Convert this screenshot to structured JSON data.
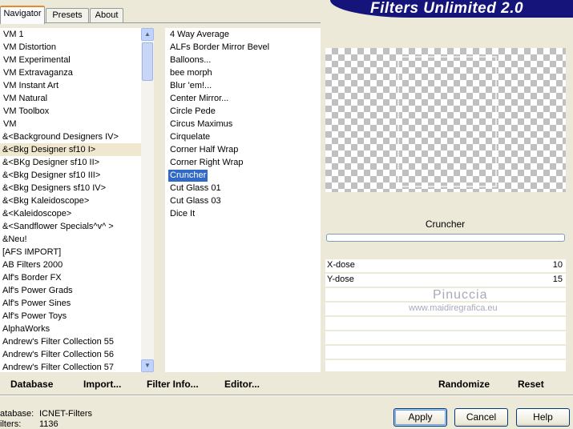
{
  "tabs": [
    {
      "label": "Navigator"
    },
    {
      "label": "Presets"
    },
    {
      "label": "About"
    }
  ],
  "title": "Filters Unlimited 2.0",
  "categories": [
    "VM 1",
    "VM Distortion",
    "VM Experimental",
    "VM Extravaganza",
    "VM Instant Art",
    "VM Natural",
    "VM Toolbox",
    "VM",
    "&<Background Designers IV>",
    "&<Bkg Designer sf10 I>",
    "&<BKg Designer sf10 II>",
    "&<Bkg Designer sf10 III>",
    "&<Bkg Designers sf10 IV>",
    "&<Bkg Kaleidoscope>",
    "&<Kaleidoscope>",
    "&<Sandflower Specials^v^ >",
    "&Neu!",
    "[AFS IMPORT]",
    "AB Filters 2000",
    "Alf's Border FX",
    "Alf's Power Grads",
    "Alf's Power Sines",
    "Alf's Power Toys",
    "AlphaWorks",
    "Andrew's Filter Collection 55",
    "Andrew's Filter Collection 56",
    "Andrew's Filter Collection 57"
  ],
  "filters": [
    "4 Way Average",
    "ALFs Border Mirror Bevel",
    "Balloons...",
    "bee morph",
    "Blur 'em!...",
    "Center Mirror...",
    "Circle Pede",
    "Circus Maximus",
    "Cirquelate",
    "Corner Half Wrap",
    "Corner Right Wrap",
    "Cruncher",
    "Cut Glass 01",
    "Cut Glass 03",
    "Dice It"
  ],
  "filter_name": "Cruncher",
  "params": [
    {
      "label": "X-dose",
      "value": "10"
    },
    {
      "label": "Y-dose",
      "value": "15"
    }
  ],
  "watermark": {
    "name": "Pinuccia",
    "url": "www.maidiregrafica.eu"
  },
  "bottom_links": {
    "database": "Database",
    "import": "Import...",
    "filter_info": "Filter Info...",
    "editor": "Editor...",
    "randomize": "Randomize",
    "reset": "Reset"
  },
  "status": {
    "database_label": "atabase:",
    "database_value": "ICNET-Filters",
    "filters_label": "ilters:",
    "filters_value": "1136"
  },
  "buttons": {
    "apply": "Apply",
    "cancel": "Cancel",
    "help": "Help"
  }
}
